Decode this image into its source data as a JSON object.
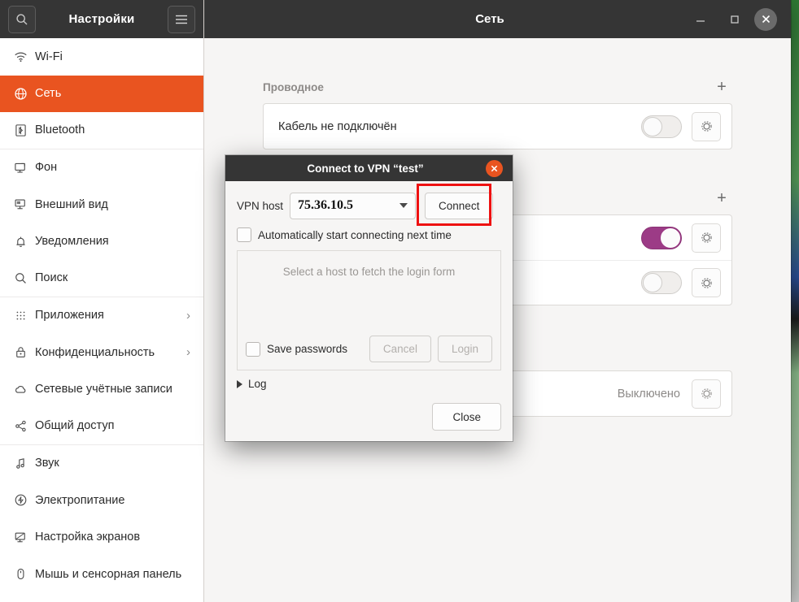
{
  "desktop": {
    "background_colors": [
      "#2f7a34",
      "#58a05c",
      "#2b4f99"
    ]
  },
  "sidebar": {
    "title": "Настройки",
    "search_icon": "search-icon",
    "menu_icon": "hamburger-menu-icon",
    "items": [
      {
        "label": "Wi-Fi",
        "icon": "wifi-icon",
        "active": false,
        "chevron": "",
        "separator": false
      },
      {
        "label": "Сеть",
        "icon": "globe-icon",
        "active": true,
        "chevron": "",
        "separator": false
      },
      {
        "label": "Bluetooth",
        "icon": "bluetooth-icon",
        "active": false,
        "chevron": "",
        "separator": true
      },
      {
        "label": "Фон",
        "icon": "wallpaper-icon",
        "active": false,
        "chevron": "",
        "separator": false
      },
      {
        "label": "Внешний вид",
        "icon": "appearance-icon",
        "active": false,
        "chevron": "",
        "separator": false
      },
      {
        "label": "Уведомления",
        "icon": "bell-icon",
        "active": false,
        "chevron": "",
        "separator": false
      },
      {
        "label": "Поиск",
        "icon": "search-icon",
        "active": false,
        "chevron": "",
        "separator": true
      },
      {
        "label": "Приложения",
        "icon": "apps-grid-icon",
        "active": false,
        "chevron": "›",
        "separator": false
      },
      {
        "label": "Конфиденциальность",
        "icon": "lock-icon",
        "active": false,
        "chevron": "›",
        "separator": false
      },
      {
        "label": "Сетевые учётные записи",
        "icon": "cloud-icon",
        "active": false,
        "chevron": "",
        "separator": false
      },
      {
        "label": "Общий доступ",
        "icon": "share-icon",
        "active": false,
        "chevron": "",
        "separator": true
      },
      {
        "label": "Звук",
        "icon": "music-note-icon",
        "active": false,
        "chevron": "",
        "separator": false
      },
      {
        "label": "Электропитание",
        "icon": "power-icon",
        "active": false,
        "chevron": "",
        "separator": false
      },
      {
        "label": "Настройка экранов",
        "icon": "display-icon",
        "active": false,
        "chevron": "",
        "separator": false
      },
      {
        "label": "Мышь и сенсорная панель",
        "icon": "mouse-icon",
        "active": false,
        "chevron": "",
        "separator": false
      }
    ]
  },
  "main_window": {
    "title": "Сеть",
    "controls": {
      "minimize": "−",
      "maximize": "□",
      "close": "✕"
    },
    "sections": [
      {
        "title": "Проводное",
        "add_label": "+",
        "rows": [
          {
            "label": "Кабель не подключён",
            "status": "",
            "toggle": "off",
            "gear": "settings-gear-icon"
          }
        ]
      },
      {
        "title": "",
        "add_label": "+",
        "rows": [
          {
            "label": "",
            "status": "",
            "toggle": "on",
            "gear": "settings-gear-icon"
          },
          {
            "label": "",
            "status": "",
            "toggle": "off",
            "gear": "settings-gear-icon"
          }
        ]
      },
      {
        "title": "",
        "add_label": "",
        "rows": [
          {
            "label": "",
            "status": "Выключено",
            "toggle": "none",
            "gear": "settings-gear-icon"
          }
        ]
      }
    ]
  },
  "dialog": {
    "title": "Connect to VPN “test”",
    "close_label": "✕",
    "host_label": "VPN host",
    "host_value": "75.36.10.5",
    "connect_label": "Connect",
    "auto_connect_label": "Automatically start connecting next time",
    "auto_connect_checked": false,
    "login_placeholder": "Select a host to fetch the login form",
    "save_passwords_label": "Save passwords",
    "save_passwords_checked": false,
    "cancel_label": "Cancel",
    "login_label": "Login",
    "log_label": "Log",
    "close_button_label": "Close",
    "highlight_color": "#ee1111",
    "highlight_target": "Connect"
  }
}
